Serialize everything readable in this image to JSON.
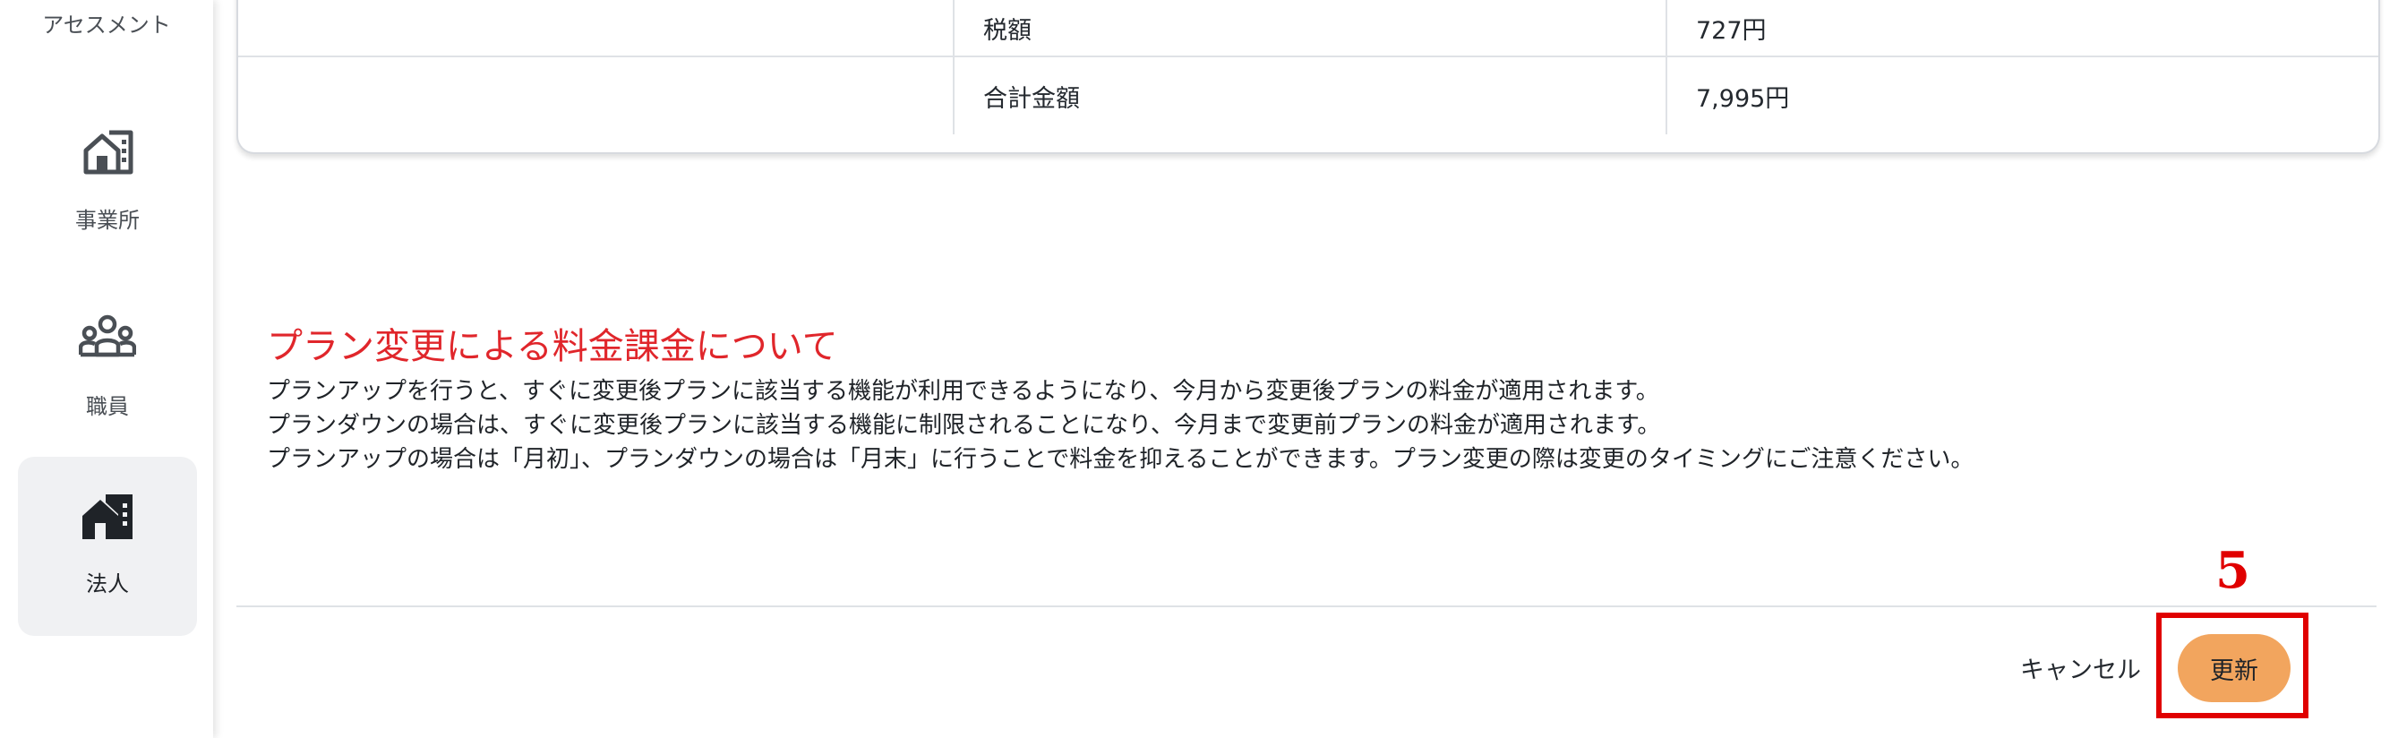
{
  "sidebar": {
    "partial_label": "アセスメント",
    "items": [
      {
        "label": "事業所",
        "icon": "office-building-icon",
        "active": false
      },
      {
        "label": "職員",
        "icon": "staff-group-icon",
        "active": false
      },
      {
        "label": "法人",
        "icon": "corporation-building-icon",
        "active": true
      }
    ]
  },
  "summary_table": {
    "rows": [
      {
        "label": "税額",
        "value": "727円"
      },
      {
        "label": "合計金額",
        "value": "7,995円"
      }
    ]
  },
  "notice": {
    "title": "プラン変更による料金課金について",
    "lines": [
      "プランアップを行うと、すぐに変更後プランに該当する機能が利用できるようになり、今月から変更後プランの料金が適用されます。",
      "プランダウンの場合は、すぐに変更後プランに該当する機能に制限されることになり、今月まで変更前プランの料金が適用されます。",
      "プランアップの場合は「月初」、プランダウンの場合は「月末」に行うことで料金を抑えることができます。プラン変更の際は変更のタイミングにご注意ください。"
    ]
  },
  "actions": {
    "cancel_label": "キャンセル",
    "update_label": "更新"
  },
  "annotation": {
    "step_number": "5",
    "color": "#e00000"
  },
  "colors": {
    "accent": "#f2a55e",
    "notice_title": "#e0262b",
    "active_nav_bg": "#f0f1f3"
  }
}
